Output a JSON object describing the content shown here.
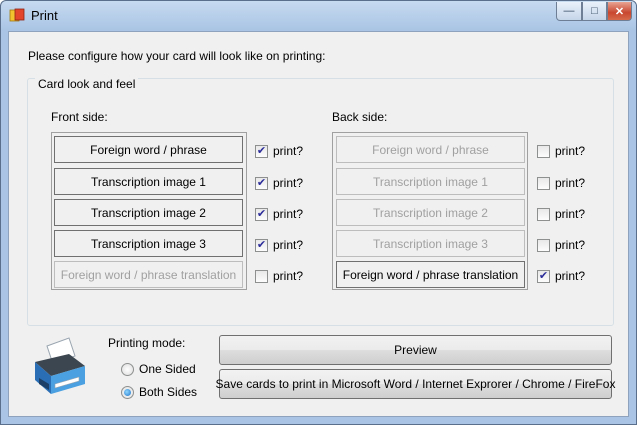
{
  "window": {
    "title": "Print"
  },
  "intro": "Please configure how your card will look like on printing:",
  "card_group": {
    "legend": "Card look and feel"
  },
  "front": {
    "label": "Front side:",
    "rows": [
      {
        "label": "Foreign word / phrase",
        "enabled": true,
        "checked": true,
        "print_label": "print?"
      },
      {
        "label": "Transcription image 1",
        "enabled": true,
        "checked": true,
        "print_label": "print?"
      },
      {
        "label": "Transcription image 2",
        "enabled": true,
        "checked": true,
        "print_label": "print?"
      },
      {
        "label": "Transcription image 3",
        "enabled": true,
        "checked": true,
        "print_label": "print?"
      },
      {
        "label": "Foreign word / phrase translation",
        "enabled": false,
        "checked": false,
        "print_label": "print?"
      }
    ]
  },
  "back": {
    "label": "Back side:",
    "rows": [
      {
        "label": "Foreign word / phrase",
        "enabled": false,
        "checked": false,
        "print_label": "print?"
      },
      {
        "label": "Transcription image 1",
        "enabled": false,
        "checked": false,
        "print_label": "print?"
      },
      {
        "label": "Transcription image 2",
        "enabled": false,
        "checked": false,
        "print_label": "print?"
      },
      {
        "label": "Transcription image 3",
        "enabled": false,
        "checked": false,
        "print_label": "print?"
      },
      {
        "label": "Foreign word / phrase translation",
        "enabled": true,
        "checked": true,
        "print_label": "print?"
      }
    ]
  },
  "printing_mode": {
    "label": "Printing mode:",
    "options": [
      {
        "label": "One Sided",
        "selected": false
      },
      {
        "label": "Both Sides",
        "selected": true
      }
    ]
  },
  "buttons": {
    "preview": "Preview",
    "save": "Save cards to print in Microsoft Word / Internet Exprorer / Chrome / FireFox"
  },
  "colors": {
    "close_button": "#c8462f",
    "titlebar": "#b9d1ea",
    "dialog_bg": "#f0f0f0"
  }
}
